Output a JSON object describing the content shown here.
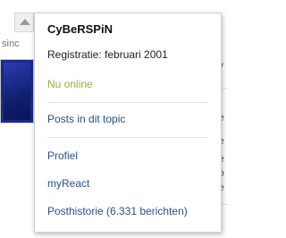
{
  "background": {
    "side_text": "sinc",
    "right_fragments": [
      "v",
      "e",
      "r",
      "e",
      "e",
      "o",
      "e",
      "j"
    ]
  },
  "popup": {
    "username": "CyBeRSPiN",
    "registration": "Registratie: februari 2001",
    "online_status": "Nu online",
    "links": {
      "posts_in_topic": "Posts in dit topic",
      "profile": "Profiel",
      "myreact": "myReact",
      "post_history": "Posthistorie (6.331 berichten)"
    }
  },
  "colors": {
    "link": "#2a4f8e",
    "online": "#8cb43a",
    "avatar": "#1a2a8a"
  }
}
